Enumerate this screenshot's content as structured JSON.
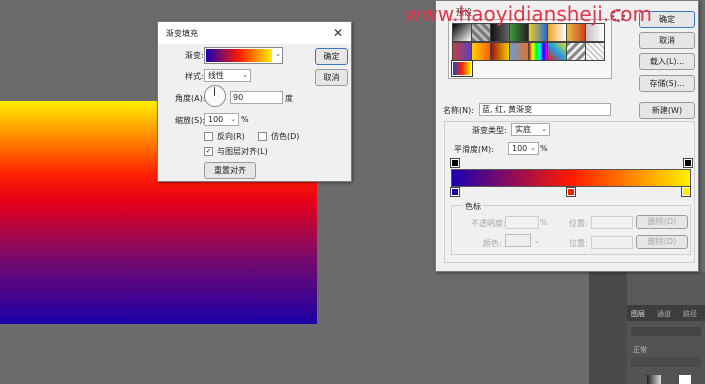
{
  "watermark": "www.haoyidiansheji.com",
  "gradient_fill_dialog": {
    "title": "渐变填充",
    "gradient_label": "渐变:",
    "style_label": "样式:",
    "style_value": "线性",
    "angle_label": "角度(A):",
    "angle_value": "90",
    "angle_unit": "度",
    "scale_label": "缩放(S):",
    "scale_value": "100",
    "scale_unit": "%",
    "reverse_label": "反向(R)",
    "dither_label": "仿色(D)",
    "align_label": "与图层对齐(L)",
    "reset_label": "重置对齐",
    "ok_label": "确定",
    "cancel_label": "取消",
    "reverse_checked": false,
    "dither_checked": false,
    "align_checked": true
  },
  "gradient_editor": {
    "presets_label": "预设",
    "ok_label": "确定",
    "cancel_label": "取消",
    "load_label": "载入(L)...",
    "save_label": "存储(S)...",
    "name_label": "名称(N):",
    "name_value": "蓝, 红, 黄渐变",
    "new_label": "新建(W)",
    "gradient_type_label": "渐变类型:",
    "gradient_type_value": "实底",
    "smoothness_label": "平滑度(M):",
    "smoothness_value": "100",
    "smoothness_unit": "%",
    "stops_group_label": "色标",
    "opacity_label": "不透明度:",
    "percent": "%",
    "location_label": "位置:",
    "delete_label": "删除(D)",
    "color_label": "颜色:",
    "location_label2": "位置:",
    "delete_label2": "删除(D)"
  },
  "panels": {
    "tabs": [
      "图层",
      "通道",
      "路径"
    ],
    "mode": "正常"
  },
  "colors": {
    "blue": "#1a00b4",
    "red": "#ff1a00",
    "yellow": "#fff000",
    "watermark": "#e2364a"
  }
}
